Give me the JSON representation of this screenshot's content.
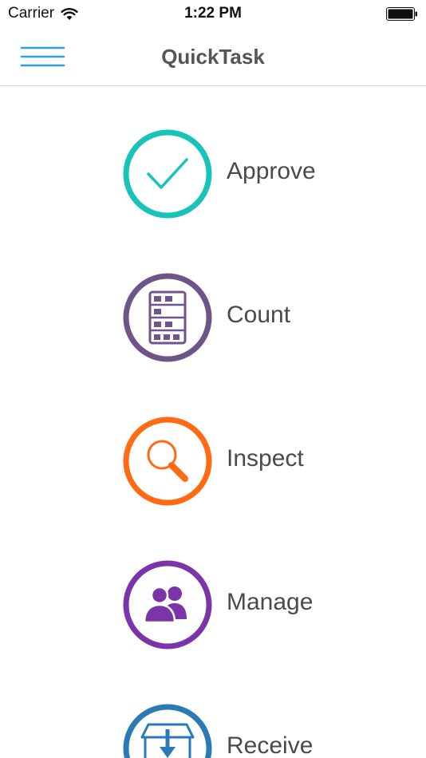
{
  "status_bar": {
    "carrier": "Carrier",
    "time": "1:22 PM"
  },
  "nav": {
    "title": "QuickTask",
    "menu_icon": "hamburger-menu-icon"
  },
  "tasks": [
    {
      "label": "Approve",
      "icon": "checkmark-icon",
      "color": "#19c3b9"
    },
    {
      "label": "Count",
      "icon": "inventory-shelf-icon",
      "color": "#6e5487"
    },
    {
      "label": "Inspect",
      "icon": "magnifier-icon",
      "color": "#ff6a13"
    },
    {
      "label": "Manage",
      "icon": "users-icon",
      "color": "#7c35a8"
    },
    {
      "label": "Receive",
      "icon": "receive-box-icon",
      "color": "#2b7ab6"
    }
  ],
  "colors": {
    "menu_accent": "#2a9fe6",
    "title_text": "#555555",
    "label_text": "#4a4a4a"
  }
}
